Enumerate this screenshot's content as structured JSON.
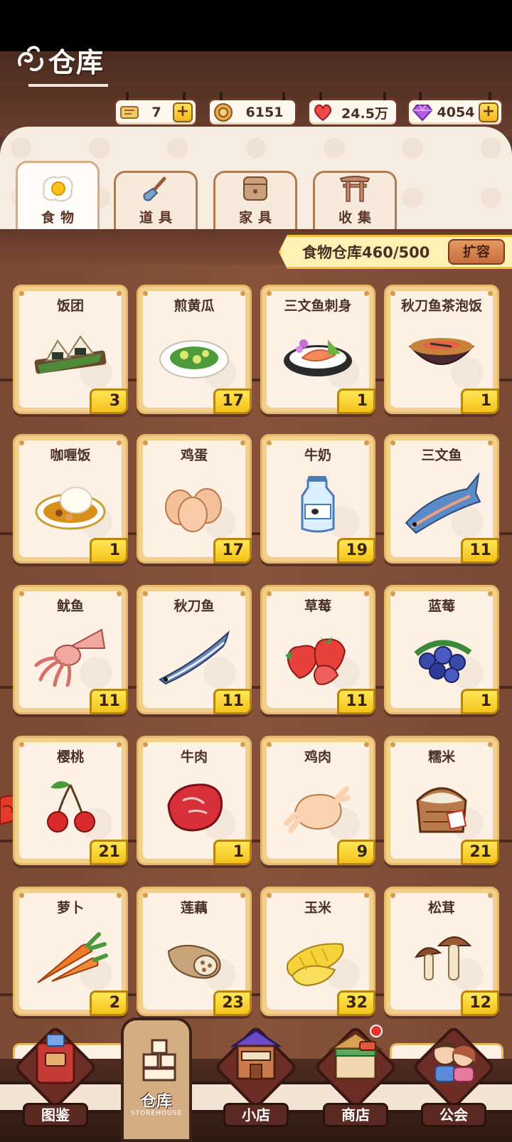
{
  "header": {
    "title": "仓库",
    "resources": [
      {
        "icon": "ticket-icon",
        "value": "7",
        "has_plus": true
      },
      {
        "icon": "coin-icon",
        "value": "6151",
        "has_plus": false
      },
      {
        "icon": "heart-icon",
        "value": "24.5万",
        "has_plus": false
      },
      {
        "icon": "gem-icon",
        "value": "4054",
        "has_plus": true
      }
    ]
  },
  "tabs": [
    {
      "label": "食物",
      "icon": "fried-egg-icon",
      "active": true
    },
    {
      "label": "道具",
      "icon": "shovel-icon",
      "active": false
    },
    {
      "label": "家具",
      "icon": "cabinet-icon",
      "active": false
    },
    {
      "label": "收集",
      "icon": "torii-gate-icon",
      "active": false
    }
  ],
  "capacity": {
    "text": "食物仓库460/500",
    "expand_label": "扩容"
  },
  "items": [
    {
      "name": "饭团",
      "count": "3",
      "icon": "rice-ball-icon"
    },
    {
      "name": "煎黄瓜",
      "count": "17",
      "icon": "fried-cucumber-icon"
    },
    {
      "name": "三文鱼刺身",
      "count": "1",
      "icon": "salmon-sashimi-icon"
    },
    {
      "name": "秋刀鱼茶泡饭",
      "count": "1",
      "icon": "saury-chazuke-icon"
    },
    {
      "name": "咖喱饭",
      "count": "1",
      "icon": "curry-rice-icon"
    },
    {
      "name": "鸡蛋",
      "count": "17",
      "icon": "egg-icon"
    },
    {
      "name": "牛奶",
      "count": "19",
      "icon": "milk-icon"
    },
    {
      "name": "三文鱼",
      "count": "11",
      "icon": "salmon-icon"
    },
    {
      "name": "鱿鱼",
      "count": "11",
      "icon": "squid-icon"
    },
    {
      "name": "秋刀鱼",
      "count": "11",
      "icon": "saury-icon"
    },
    {
      "name": "草莓",
      "count": "11",
      "icon": "strawberry-icon"
    },
    {
      "name": "蓝莓",
      "count": "1",
      "icon": "blueberry-icon"
    },
    {
      "name": "樱桃",
      "count": "21",
      "icon": "cherry-icon"
    },
    {
      "name": "牛肉",
      "count": "1",
      "icon": "beef-icon"
    },
    {
      "name": "鸡肉",
      "count": "9",
      "icon": "chicken-icon"
    },
    {
      "name": "糯米",
      "count": "21",
      "icon": "rice-sack-icon"
    },
    {
      "name": "萝卜",
      "count": "2",
      "icon": "carrot-icon"
    },
    {
      "name": "莲藕",
      "count": "23",
      "icon": "lotus-root-icon"
    },
    {
      "name": "玉米",
      "count": "32",
      "icon": "corn-icon"
    },
    {
      "name": "松茸",
      "count": "12",
      "icon": "mushroom-icon"
    }
  ],
  "nav": [
    {
      "label": "图鉴",
      "icon": "book-icon"
    },
    {
      "label": "仓库",
      "sub": "STOREHOUSE",
      "icon": "boxes-icon",
      "active": true
    },
    {
      "label": "小店",
      "icon": "shop-icon"
    },
    {
      "label": "商店",
      "icon": "store-icon",
      "badge": true
    },
    {
      "label": "公会",
      "icon": "guild-icon"
    }
  ],
  "colors": {
    "wood": "#7b4a33",
    "card_border": "#f2cf8b",
    "count_badge": "#f4c21c",
    "panel": "#f6ece2"
  }
}
